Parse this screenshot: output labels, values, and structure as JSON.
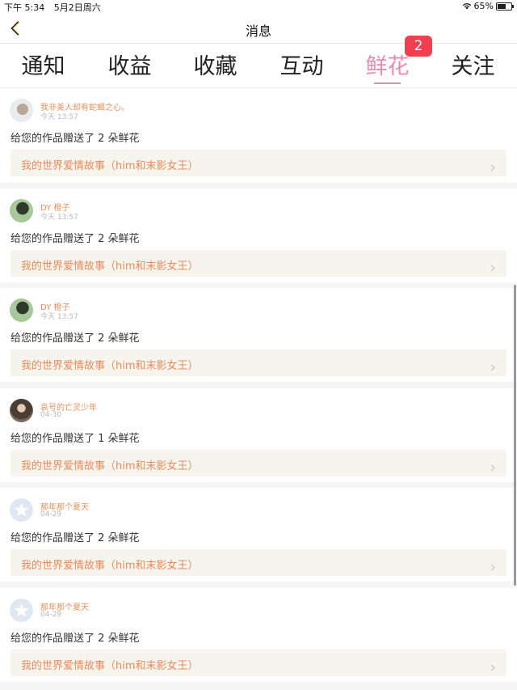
{
  "status_bar": {
    "time": "下午 5:34",
    "date": "5月2日周六",
    "battery": "65%"
  },
  "nav": {
    "title": "消息"
  },
  "tabs": [
    {
      "label": "通知",
      "active": false
    },
    {
      "label": "收益",
      "active": false
    },
    {
      "label": "收藏",
      "active": false
    },
    {
      "label": "互动",
      "active": false
    },
    {
      "label": "鲜花",
      "active": true
    },
    {
      "label": "关注",
      "active": false
    }
  ],
  "tab_badge": {
    "tab": "鲜花",
    "count": "2"
  },
  "colors": {
    "accent": "#e98ab3",
    "badge": "#f0404f",
    "username": "#e3915d",
    "link": "#e68a5c"
  },
  "messages": [
    {
      "user": "我非美人却有蛇蝎之心。",
      "time": "今天 13:57",
      "text": "给您的作品赠送了 2 朵鲜花",
      "work": "我的世界爱情故事（him和末影女王）",
      "avatar": "photo1"
    },
    {
      "user": "DY 橙子",
      "time": "今天 13:57",
      "text": "给您的作品赠送了 2 朵鲜花",
      "work": "我的世界爱情故事（him和末影女王）",
      "avatar": "photo2"
    },
    {
      "user": "DY 橙子",
      "time": "今天 13:57",
      "text": "给您的作品赠送了 2 朵鲜花",
      "work": "我的世界爱情故事（him和末影女王）",
      "avatar": "photo2"
    },
    {
      "user": "哀号的亡灵少年",
      "time": "04-30",
      "text": "给您的作品赠送了 1 朵鲜花",
      "work": "我的世界爱情故事（him和末影女王）",
      "avatar": "photo3"
    },
    {
      "user": "那年那个夏天",
      "time": "04-29",
      "text": "给您的作品赠送了 2 朵鲜花",
      "work": "我的世界爱情故事（him和末影女王）",
      "avatar": "default"
    },
    {
      "user": "那年那个夏天",
      "time": "04-29",
      "text": "给您的作品赠送了 2 朵鲜花",
      "work": "我的世界爱情故事（him和末影女王）",
      "avatar": "default"
    }
  ]
}
